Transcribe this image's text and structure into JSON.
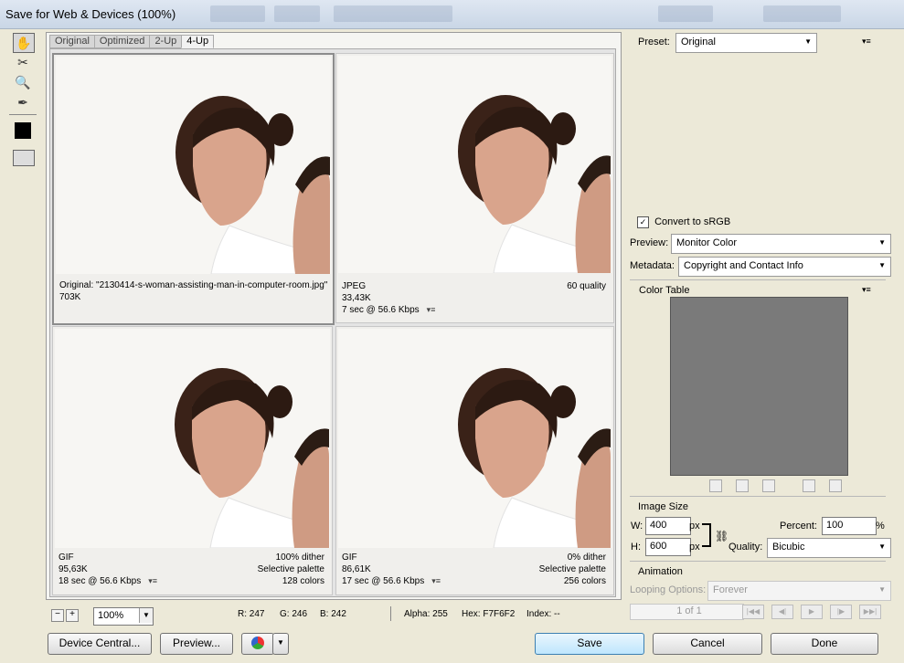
{
  "window": {
    "title": "Save for Web & Devices (100%)"
  },
  "tabs": [
    "Original",
    "Optimized",
    "2-Up",
    "4-Up"
  ],
  "panes": [
    {
      "left": "Original: \"2130414-s-woman-assisting-man-in-computer-room.jpg\"",
      "left2": "703K",
      "left3": "",
      "right1": "",
      "right2": "",
      "right3": ""
    },
    {
      "left": "JPEG",
      "left2": "33,43K",
      "left3": "7 sec @ 56.6 Kbps",
      "right1": "60 quality",
      "right2": "",
      "right3": ""
    },
    {
      "left": "GIF",
      "left2": "95,63K",
      "left3": "18 sec @ 56.6 Kbps",
      "right1": "100% dither",
      "right2": "Selective palette",
      "right3": "128 colors"
    },
    {
      "left": "GIF",
      "left2": "86,61K",
      "left3": "17 sec @ 56.6 Kbps",
      "right1": "0% dither",
      "right2": "Selective palette",
      "right3": "256 colors"
    }
  ],
  "status": {
    "zoom": "100%",
    "r": "R: 247",
    "g": "G: 246",
    "b": "B: 242",
    "alpha": "Alpha: 255",
    "hex": "Hex: F7F6F2",
    "index": "Index: --"
  },
  "buttons": {
    "device_central": "Device Central...",
    "preview": "Preview...",
    "save": "Save",
    "cancel": "Cancel",
    "done": "Done"
  },
  "settings": {
    "preset_label": "Preset:",
    "preset_value": "Original",
    "convert_srgb": "Convert to sRGB",
    "preview_label": "Preview:",
    "preview_value": "Monitor Color",
    "metadata_label": "Metadata:",
    "metadata_value": "Copyright and Contact Info",
    "color_table": "Color Table"
  },
  "image_size": {
    "title": "Image Size",
    "w_label": "W:",
    "w_value": "400",
    "w_unit": "px",
    "h_label": "H:",
    "h_value": "600",
    "h_unit": "px",
    "percent_label": "Percent:",
    "percent_value": "100",
    "percent_unit": "%",
    "quality_label": "Quality:",
    "quality_value": "Bicubic"
  },
  "animation": {
    "title": "Animation",
    "looping_label": "Looping Options:",
    "looping_value": "Forever",
    "frame": "1 of 1"
  },
  "colors": {
    "accent": "#3c7fb1",
    "panel": "#ece9d8",
    "color_table_bg": "#7a7a7a"
  }
}
